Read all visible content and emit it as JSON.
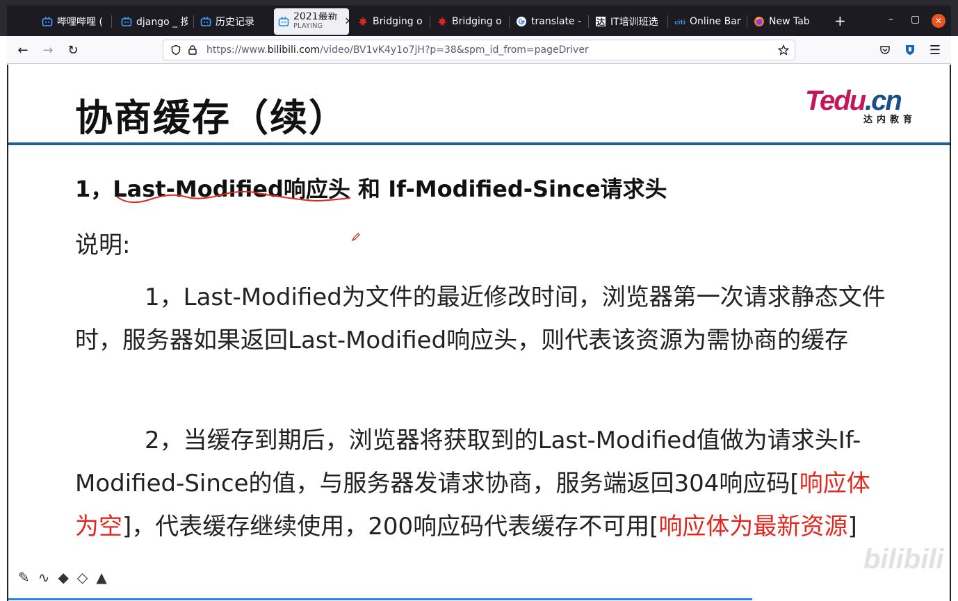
{
  "browser": {
    "tabs": [
      {
        "label": "哔哩哔哩 (",
        "icon": "bilibili-icon"
      },
      {
        "label": "django _ 按",
        "icon": "bilibili-icon"
      },
      {
        "label": "历史记录",
        "icon": "bilibili-icon"
      },
      {
        "label": "2021最新",
        "sub": "PLAYING",
        "icon": "bilibili-icon",
        "active": true
      },
      {
        "label": "Bridging o",
        "icon": "maple-leaf-icon"
      },
      {
        "label": "Bridging o",
        "icon": "maple-leaf-icon"
      },
      {
        "label": "translate -",
        "icon": "google-icon"
      },
      {
        "label": "IT培训班选",
        "icon": "da-icon"
      },
      {
        "label": "Online Ban",
        "icon": "citi-icon"
      },
      {
        "label": "New Tab",
        "icon": "firefox-icon"
      }
    ],
    "new_tab": "+",
    "url_prefix": "https://www.",
    "url_domain": "bilibili.com",
    "url_path": "/video/BV1vK4y1o7jH?p=38&spm_id_from=pageDriver",
    "accent": "#e95420"
  },
  "slide": {
    "title": "协商缓存（续）",
    "logo_main_t": "Tedu",
    "logo_main_r": ".cn",
    "logo_sub": "达内教育",
    "heading": "1，Last-Modified响应头 和 If-Modified-Since请求头",
    "subhead": "说明:",
    "para1": "1，Last-Modified为文件的最近修改时间，浏览器第一次请求静态文件时，服务器如果返回Last-Modified响应头，则代表该资源为需协商的缓存",
    "para2_a": "2，当缓存到期后，浏览器将获取到的Last-Modified值做为请求头If-Modified-Since的值，与服务器发请求协商，服务端返回304响应码[",
    "para2_red1": "响应体为空",
    "para2_b": "]，代表缓存继续使用，200响应码代表缓存不可用[",
    "para2_red2": "响应体为最新资源",
    "para2_c": "]",
    "watermark": "bilibili",
    "colors": {
      "rule": "#1f5c99",
      "red": "#e0281f"
    }
  },
  "video": {
    "progress": 0.79
  }
}
